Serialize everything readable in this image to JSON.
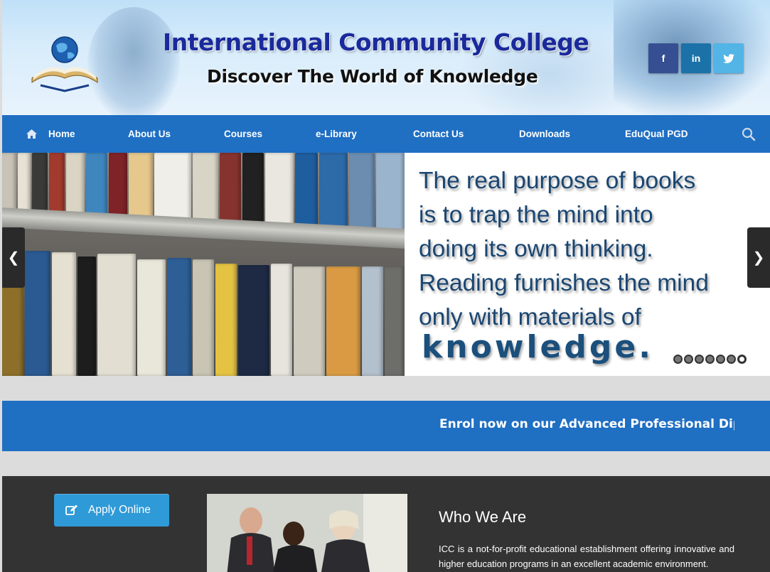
{
  "header": {
    "title": "International Community College",
    "tagline": "Discover The World of Knowledge",
    "social": [
      {
        "name": "facebook",
        "label": "f",
        "color": "#364f92"
      },
      {
        "name": "linkedin",
        "label": "in",
        "color": "#1b72a8"
      },
      {
        "name": "twitter",
        "label": "twitter-bird-icon",
        "color": "#53b4e6"
      }
    ]
  },
  "nav": {
    "items": [
      {
        "label": "Home",
        "icon": "home-icon"
      },
      {
        "label": "About Us"
      },
      {
        "label": "Courses"
      },
      {
        "label": "e-Library"
      },
      {
        "label": "Contact Us"
      },
      {
        "label": "Downloads"
      },
      {
        "label": "EduQual PGD"
      }
    ],
    "search_icon": "search-icon",
    "color": "#1f6fc3"
  },
  "slider": {
    "quote_lines": [
      "The real purpose of books",
      "is to trap the mind into",
      "doing its own thinking.",
      "Reading furnishes the mind",
      "only with materials of"
    ],
    "quote_emphasis": "knowledge.",
    "dot_count": 7,
    "active_dot": 7
  },
  "announcement": {
    "text": "Enrol now on our Advanced Professional Dip"
  },
  "apply": {
    "label": "Apply Online",
    "color": "#2f9ad8"
  },
  "about": {
    "title": "Who We Are",
    "text": "ICC is a not-for-profit educational establishment offering innovative and higher education programs in an excellent academic environment."
  }
}
